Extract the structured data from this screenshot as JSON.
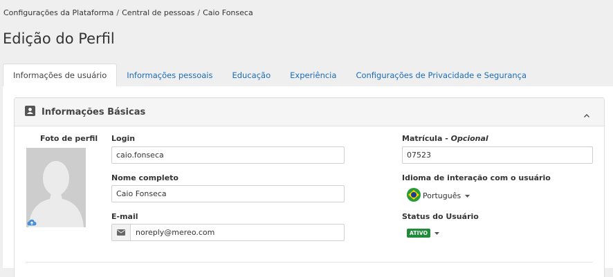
{
  "breadcrumb": {
    "items": [
      "Configurações da Plataforma",
      "Central de pessoas",
      "Caio Fonseca"
    ],
    "separator": "/"
  },
  "page_title": "Edição do Perfil",
  "tabs": [
    {
      "label": "Informações de usuário",
      "active": true
    },
    {
      "label": "Informações pessoais",
      "active": false
    },
    {
      "label": "Educação",
      "active": false
    },
    {
      "label": "Experiência",
      "active": false
    },
    {
      "label": "Configurações de Privacidade e Segurança",
      "active": false
    }
  ],
  "panel": {
    "title": "Informações Básicas",
    "icon": "contact-card-icon",
    "collapse_icon": "chevron-up-icon"
  },
  "photo": {
    "label": "Foto de perfil",
    "upload_icon": "cloud-upload-icon"
  },
  "form": {
    "login_label": "Login",
    "login_value": "caio.fonseca",
    "fullname_label": "Nome completo",
    "fullname_value": "Caio Fonseca",
    "email_label": "E-mail",
    "email_value": "noreply@mereo.com",
    "email_icon": "envelope-icon",
    "matricula_label": "Matrícula - ",
    "matricula_optional": "Opcional",
    "matricula_value": "07523",
    "language_label": "Idioma de interação com o usuário",
    "language_value": "Português",
    "language_flag": "brazil-flag-icon",
    "status_label": "Status do Usuário",
    "status_value": "ATIVO"
  },
  "colors": {
    "link": "#1a6bb8",
    "status_badge": "#1e8c3a",
    "background": "#efefef"
  }
}
